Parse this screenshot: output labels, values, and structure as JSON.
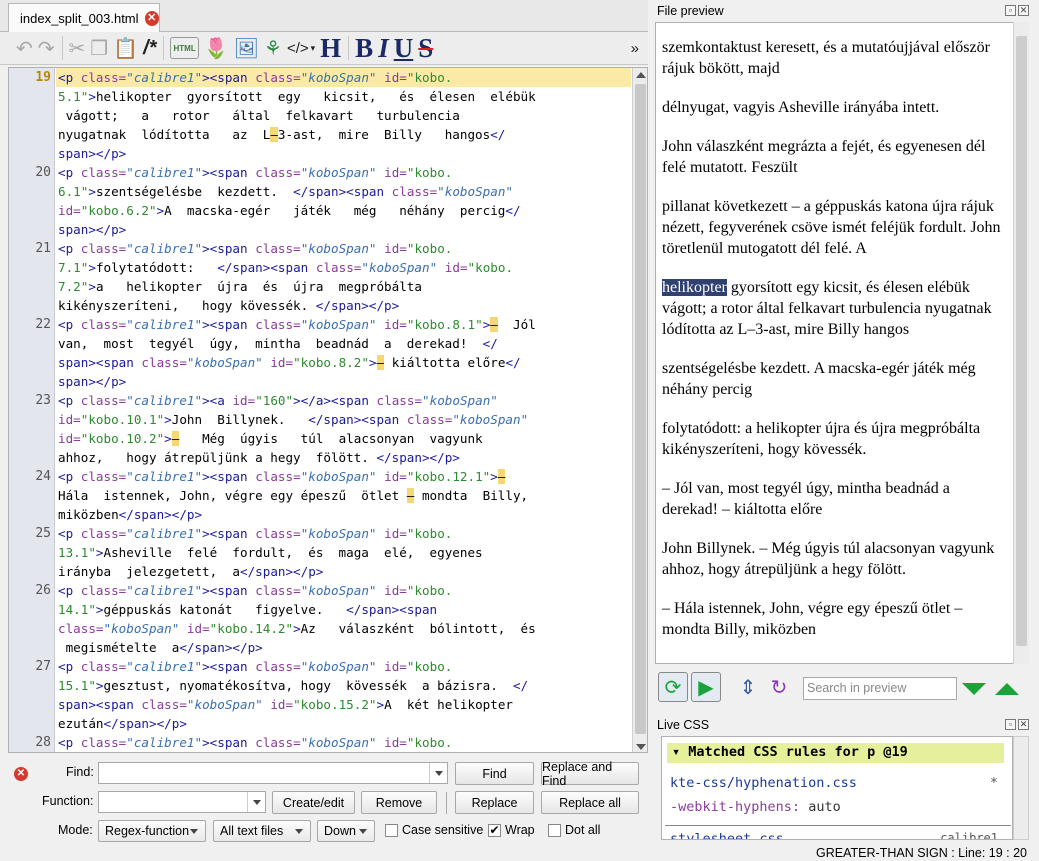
{
  "tab": {
    "filename": "index_split_003.html"
  },
  "toolbar": {
    "icons": [
      "undo-icon",
      "redo-icon",
      "cut-icon",
      "copy-icon",
      "paste-icon",
      "comment-icon",
      "html-icon",
      "tulip-icon",
      "image-icon",
      "link-icon",
      "code-icon",
      "heading-icon",
      "bold-icon",
      "italic-icon",
      "underline-icon",
      "strikethrough-icon"
    ],
    "comment_label": "/*",
    "html_label": "HTML",
    "code_label": "</>",
    "heading_label": "H",
    "bold_label": "B",
    "italic_label": "I",
    "underline_label": "U",
    "strike_label": "S",
    "overflow_label": "»"
  },
  "editor": {
    "current_line": "19",
    "line_numbers": [
      "19",
      "20",
      "21",
      "22",
      "23",
      "24",
      "25",
      "26",
      "27",
      "28"
    ]
  },
  "find": {
    "find_label": "Find:",
    "function_label": "Function:",
    "mode_label": "Mode:",
    "find_value": "",
    "function_value": "",
    "find_button": "Find",
    "replace_and_find_button": "Replace and Find",
    "create_edit_button": "Create/edit",
    "remove_button": "Remove",
    "replace_button": "Replace",
    "replace_all_button": "Replace all",
    "mode_value": "Regex-function",
    "scope_value": "All text files",
    "direction_value": "Down",
    "case_sensitive_label": "Case sensitive",
    "case_sensitive_checked": false,
    "wrap_label": "Wrap",
    "wrap_checked": true,
    "dot_all_label": "Dot all",
    "dot_all_checked": false
  },
  "preview": {
    "title": "File preview",
    "search_placeholder": "Search in preview",
    "paragraphs": [
      "szemkontaktust keresett, és a mutatóujjával először rájuk bökött, majd",
      "délnyugat, vagyis Asheville irányába intett.",
      "John válaszként megrázta a fejét, és egyenesen dél felé mutatott. Feszült",
      "pillanat következett – a géppuskás katona újra rájuk nézett, fegyverének csöve ismét feléjük fordult. John töretlenül mutogatott dél felé. A",
      "gyorsított egy kicsit, és élesen elébük vágott; a rotor által felkavart turbulencia nyugatnak lódította az L–3-ast, mire Billy hangos",
      "szentségelésbe kezdett. A macska-egér játék még néhány percig",
      "folytatódott: a helikopter újra és újra megpróbálta kikényszeríteni, hogy kövessék.",
      "– Jól van, most tegyél úgy, mintha beadnád a derekad! – kiáltotta előre",
      "John Billynek. – Még úgyis túl alacsonyan vagyunk ahhoz, hogy átrepüljünk a hegy fölött.",
      "– Hála istennek, John, végre egy épeszű ötlet – mondta Billy, miközben"
    ],
    "selected_word": "helikopter"
  },
  "live_css": {
    "title": "Live CSS",
    "header": "▾ Matched CSS rules for p @19",
    "file1": "kte-css/hyphenation.css",
    "file1_marker": "*",
    "prop1": "-webkit-hyphens:",
    "val1": "auto",
    "file2": "stylesheet.css",
    "file2_selector": "calibre1"
  },
  "status": {
    "text": "GREATER-THAN SIGN : Line: 19 : 20"
  },
  "colors": {
    "current_line": "#fbe9a8",
    "accent_green": "#19a33a",
    "css_header": "#e6f09a"
  }
}
